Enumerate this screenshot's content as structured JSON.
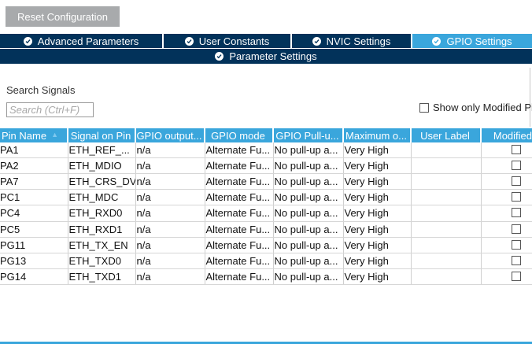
{
  "toolbar": {
    "reset_label": "Reset Configuration"
  },
  "tabs": [
    {
      "label": "Advanced Parameters",
      "active": false
    },
    {
      "label": "User Constants",
      "active": false
    },
    {
      "label": "NVIC Settings",
      "active": false
    },
    {
      "label": "GPIO Settings",
      "active": true
    }
  ],
  "parameter_settings": {
    "label": "Parameter Settings"
  },
  "search": {
    "label": "Search Signals",
    "placeholder": "Search (Ctrl+F)",
    "value": ""
  },
  "show_modified": {
    "label": "Show only Modified Pins",
    "checked": false
  },
  "table": {
    "columns": [
      "Pin Name",
      "Signal on Pin",
      "GPIO output...",
      "GPIO mode",
      "GPIO Pull-u...",
      "Maximum o...",
      "User Label",
      "Modified"
    ],
    "sorted_column": "Pin Name",
    "rows": [
      {
        "pin": "PA1",
        "signal": "ETH_REF_...",
        "output": "n/a",
        "mode": "Alternate Fu...",
        "pull": "No pull-up a...",
        "speed": "Very High",
        "label": "",
        "modified": false
      },
      {
        "pin": "PA2",
        "signal": "ETH_MDIO",
        "output": "n/a",
        "mode": "Alternate Fu...",
        "pull": "No pull-up a...",
        "speed": "Very High",
        "label": "",
        "modified": false
      },
      {
        "pin": "PA7",
        "signal": "ETH_CRS_DV",
        "output": "n/a",
        "mode": "Alternate Fu...",
        "pull": "No pull-up a...",
        "speed": "Very High",
        "label": "",
        "modified": false
      },
      {
        "pin": "PC1",
        "signal": "ETH_MDC",
        "output": "n/a",
        "mode": "Alternate Fu...",
        "pull": "No pull-up a...",
        "speed": "Very High",
        "label": "",
        "modified": false
      },
      {
        "pin": "PC4",
        "signal": "ETH_RXD0",
        "output": "n/a",
        "mode": "Alternate Fu...",
        "pull": "No pull-up a...",
        "speed": "Very High",
        "label": "",
        "modified": false
      },
      {
        "pin": "PC5",
        "signal": "ETH_RXD1",
        "output": "n/a",
        "mode": "Alternate Fu...",
        "pull": "No pull-up a...",
        "speed": "Very High",
        "label": "",
        "modified": false
      },
      {
        "pin": "PG11",
        "signal": "ETH_TX_EN",
        "output": "n/a",
        "mode": "Alternate Fu...",
        "pull": "No pull-up a...",
        "speed": "Very High",
        "label": "",
        "modified": false
      },
      {
        "pin": "PG13",
        "signal": "ETH_TXD0",
        "output": "n/a",
        "mode": "Alternate Fu...",
        "pull": "No pull-up a...",
        "speed": "Very High",
        "label": "",
        "modified": false
      },
      {
        "pin": "PG14",
        "signal": "ETH_TXD1",
        "output": "n/a",
        "mode": "Alternate Fu...",
        "pull": "No pull-up a...",
        "speed": "Very High",
        "label": "",
        "modified": false
      }
    ]
  },
  "icons": {
    "tab_icon": "check-circle-icon",
    "sort_icon": "sort-ascending-icon"
  },
  "colors": {
    "navy": "#02325a",
    "accent": "#3aa6dc",
    "button_gray": "#a8aaac"
  }
}
